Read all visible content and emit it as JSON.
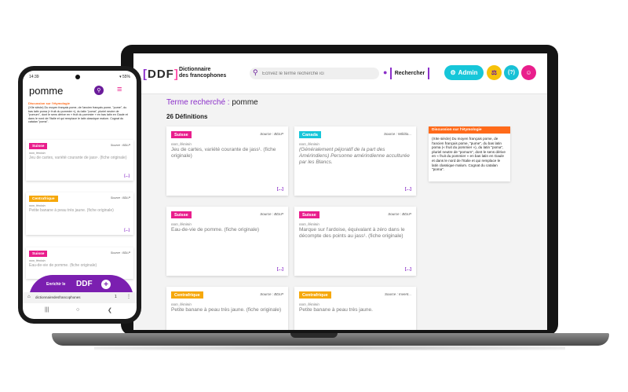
{
  "laptop": {
    "brand_logo": "DDF",
    "brand_text_1": "Dictionnaire",
    "brand_text_2": "des francophones",
    "search_placeholder": "Écrivez le terme recherché ici",
    "search_button": "Rechercher",
    "admin_button": "Admin",
    "term_label": "Terme recherché : ",
    "term": "pomme",
    "definitions_count": "26 Définitions",
    "cards": [
      {
        "tag": "Suisse",
        "source": "Source : BDLP",
        "category": "nom_féminin",
        "definition": "Jeu de cartes, variété courante de jass¹. (fiche originale)",
        "more": "[...]"
      },
      {
        "tag": "Canada",
        "source": "Source : Wikitio...",
        "category": "nom_féminin",
        "definition": "(Généralement péjoratif de la part des Amérindiens) Personne amérindienne acculturée par les Blancs.",
        "more": "[...]"
      },
      {
        "tag": "Suisse",
        "source": "Source : BDLP",
        "category": "nom_féminin",
        "definition": "Eau-de-vie de pomme. (fiche originale)",
        "more": "[...]"
      },
      {
        "tag": "Suisse",
        "source": "Source : BDLP",
        "category": "nom_féminin",
        "definition": "Marque sur l'ardoise, équivalant à zéro dans le décompte des points au jass¹. (fiche originale)",
        "more": "[...]"
      },
      {
        "tag": "Centrafrique",
        "source": "Source : BDLP",
        "category": "nom_féminin",
        "definition": "Petite banane à peau très jaune. (fiche originale)",
        "more": ""
      },
      {
        "tag": "Centrafrique",
        "source": "Source : Invent...",
        "category": "nom_féminin",
        "definition": "Petite banane à peau très jaune.",
        "more": ""
      }
    ],
    "etymology": {
      "title": "Discussion sur l'étymologie",
      "text": "(XIIe siècle) Du moyen français pome, de l'ancien français pome, \"pume\", du bas latin poma (« fruit du pommier »), du latin \"poma\", pluriel neutre de \"pomum\", dont le sens dérive en « fruit du pommier » en bas latin en Gaule et dans le nord de l'Italie et qui remplace le latin classique malum. Cognat du catalan \"poma\"."
    }
  },
  "phone": {
    "status_time": "14:39",
    "status_battery": "▾ 55%",
    "title": "pomme",
    "etymology_title": "Discussion sur l'étymologie",
    "etymology_text": "(XIIe siècle) Du moyen français pome, de l'ancien français pome, \"pume\", du bas latin poma (« fruit du pommier »), du latin \"poma\", pluriel neutre de \"pomum\", dont le sens dérive en « fruit du pommier » en bas latin en Gaule et dans le nord de l'Italie et qui remplace le latin classique malum. Cognat du catalan \"poma\".",
    "cards": [
      {
        "tag": "Suisse",
        "source": "Source : BDLP",
        "category": "nom_féminin",
        "definition": "Jeu de cartes, variété courante de jass¹. (fiche originale)",
        "more": "[...]"
      },
      {
        "tag": "Centrafrique",
        "source": "Source : BDLP",
        "category": "nom_féminin",
        "definition": "Petite banane à peau très jaune. (fiche originale)",
        "more": "[...]"
      },
      {
        "tag": "Suisse",
        "source": "Source : BDLP",
        "category": "nom_féminin",
        "definition": "Eau-de-vie de pomme. (fiche originale)",
        "more": ""
      }
    ],
    "enrich_label": "Enrichir le",
    "enrich_brand": "DDF",
    "url": "dictionnairedesfrancophones",
    "tabs_count": "1"
  }
}
